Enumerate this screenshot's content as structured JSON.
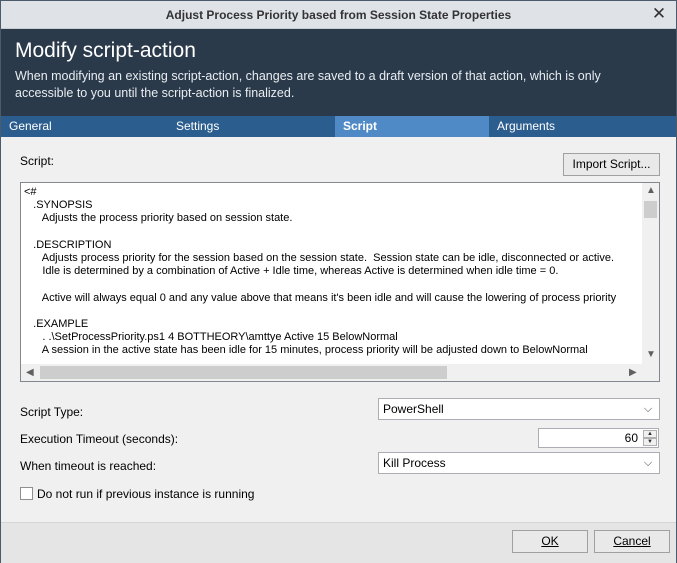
{
  "window": {
    "title": "Adjust Process Priority based from Session State Properties",
    "close_glyph": "✕"
  },
  "header": {
    "title": "Modify script-action",
    "description": "When modifying an existing script-action, changes are saved to a draft version of that action, which is only accessible to you until the script-action is finalized."
  },
  "tabs": [
    {
      "label": "General",
      "active": false
    },
    {
      "label": "Settings",
      "active": false
    },
    {
      "label": "Script",
      "active": true
    },
    {
      "label": "Arguments",
      "active": false
    }
  ],
  "script": {
    "label": "Script:",
    "import_button": "Import Script...",
    "content": "<#\n   .SYNOPSIS\n      Adjusts the process priority based on session state.\n\n   .DESCRIPTION\n      Adjusts process priority for the session based on the session state.  Session state can be idle, disconnected or active.\n      Idle is determined by a combination of Active + Idle time, whereas Active is determined when idle time = 0.\n\n      Active will always equal 0 and any value above that means it's been idle and will cause the lowering of process priority\n\n   .EXAMPLE\n      . .\\SetProcessPriority.ps1 4 BOTTHEORY\\amttye Active 15 BelowNormal\n      A session in the active state has been idle for 15 minutes, process priority will be adjusted down to BelowNormal"
  },
  "fields": {
    "script_type_label": "Script Type:",
    "script_type_value": "PowerShell",
    "timeout_label": "Execution Timeout (seconds):",
    "timeout_value": "60",
    "timeout_action_label": "When timeout is reached:",
    "timeout_action_value": "Kill Process",
    "no_run_label": "Do not run if previous instance is running",
    "no_run_checked": false
  },
  "footer": {
    "ok_label": "OK",
    "cancel_label": "Cancel"
  },
  "colors": {
    "header_bg": "#2b3a4a",
    "tab_bar": "#2c5d8f",
    "tab_active": "#4f8ac6"
  }
}
